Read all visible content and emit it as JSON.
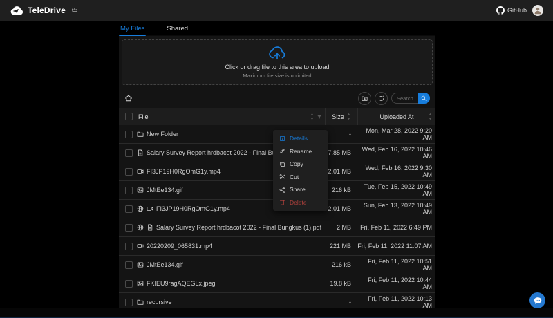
{
  "colors": {
    "accent": "#177ddc",
    "danger": "#b4423d",
    "navbar": "#1f1f1f",
    "content": "#141414",
    "header_row": "#1d1d1d"
  },
  "header": {
    "app_name": "TeleDrive",
    "github_label": "GitHub",
    "icons": {
      "logo": "telegram-cloud",
      "premium": "crown",
      "repo": "github",
      "account": "avatar"
    }
  },
  "tabs": [
    {
      "label": "My Files",
      "active": true
    },
    {
      "label": "Shared",
      "active": false
    }
  ],
  "upload": {
    "icon": "cloud-upload",
    "title": "Click or drag file to this area to upload",
    "subtitle": "Maximum file size is unlimited"
  },
  "toolbar": {
    "search_placeholder": "Search...",
    "icons": {
      "breadcrumb_home": "home",
      "new_folder": "folder-add",
      "refresh": "sync",
      "search": "magnifier"
    }
  },
  "table": {
    "columns": {
      "file": "File",
      "size": "Size",
      "uploaded": "Uploaded At"
    },
    "header_icons": {
      "sort": "caret-up-down",
      "filter": "funnel",
      "shared_marker": "globe"
    },
    "rows": [
      {
        "type": "folder",
        "shared": false,
        "name": "New Folder",
        "size": "-",
        "uploaded": "Mon, Mar 28, 2022 9:20 AM"
      },
      {
        "type": "pdf",
        "shared": false,
        "name": "Salary Survey Report hrdbacot 2022 - Final Bungkus.pdf",
        "size": "7.85 MB",
        "uploaded": "Wed, Feb 16, 2022 10:46 AM"
      },
      {
        "type": "video",
        "shared": false,
        "name": "FI3JP19H0RgOmG1y.mp4",
        "size": "2.01 MB",
        "uploaded": "Wed, Feb 16, 2022 9:30 AM"
      },
      {
        "type": "image",
        "shared": false,
        "name": "JMtEe134.gif",
        "size": "216 kB",
        "uploaded": "Tue, Feb 15, 2022 10:49 AM"
      },
      {
        "type": "video",
        "shared": true,
        "name": "FI3JP19H0RgOmG1y.mp4",
        "size": "2.01 MB",
        "uploaded": "Sun, Feb 13, 2022 10:49 AM"
      },
      {
        "type": "pdf",
        "shared": true,
        "name": "Salary Survey Report hrdbacot 2022 - Final Bungkus (1).pdf",
        "size": "2 MB",
        "uploaded": "Fri, Feb 11, 2022 6:49 PM"
      },
      {
        "type": "video",
        "shared": false,
        "name": "20220209_065831.mp4",
        "size": "221 MB",
        "uploaded": "Fri, Feb 11, 2022 11:07 AM"
      },
      {
        "type": "image",
        "shared": false,
        "name": "JMtEe134.gif",
        "size": "216 kB",
        "uploaded": "Fri, Feb 11, 2022 10:51 AM"
      },
      {
        "type": "image",
        "shared": false,
        "name": "FKIEU9ragAQEGLx.jpeg",
        "size": "19.8 kB",
        "uploaded": "Fri, Feb 11, 2022 10:44 AM"
      },
      {
        "type": "folder",
        "shared": false,
        "name": "recursive",
        "size": "-",
        "uploaded": "Fri, Feb 11, 2022 10:13 AM"
      }
    ]
  },
  "context_menu": {
    "items": [
      {
        "label": "Details",
        "icon": "info-square",
        "variant": "accent"
      },
      {
        "label": "Rename",
        "icon": "edit",
        "variant": ""
      },
      {
        "label": "Copy",
        "icon": "copy",
        "variant": ""
      },
      {
        "label": "Cut",
        "icon": "scissors",
        "variant": ""
      },
      {
        "label": "Share",
        "icon": "share-alt",
        "variant": ""
      },
      {
        "label": "Delete",
        "icon": "trash",
        "variant": "danger"
      }
    ]
  },
  "fab": {
    "icon": "chat"
  }
}
